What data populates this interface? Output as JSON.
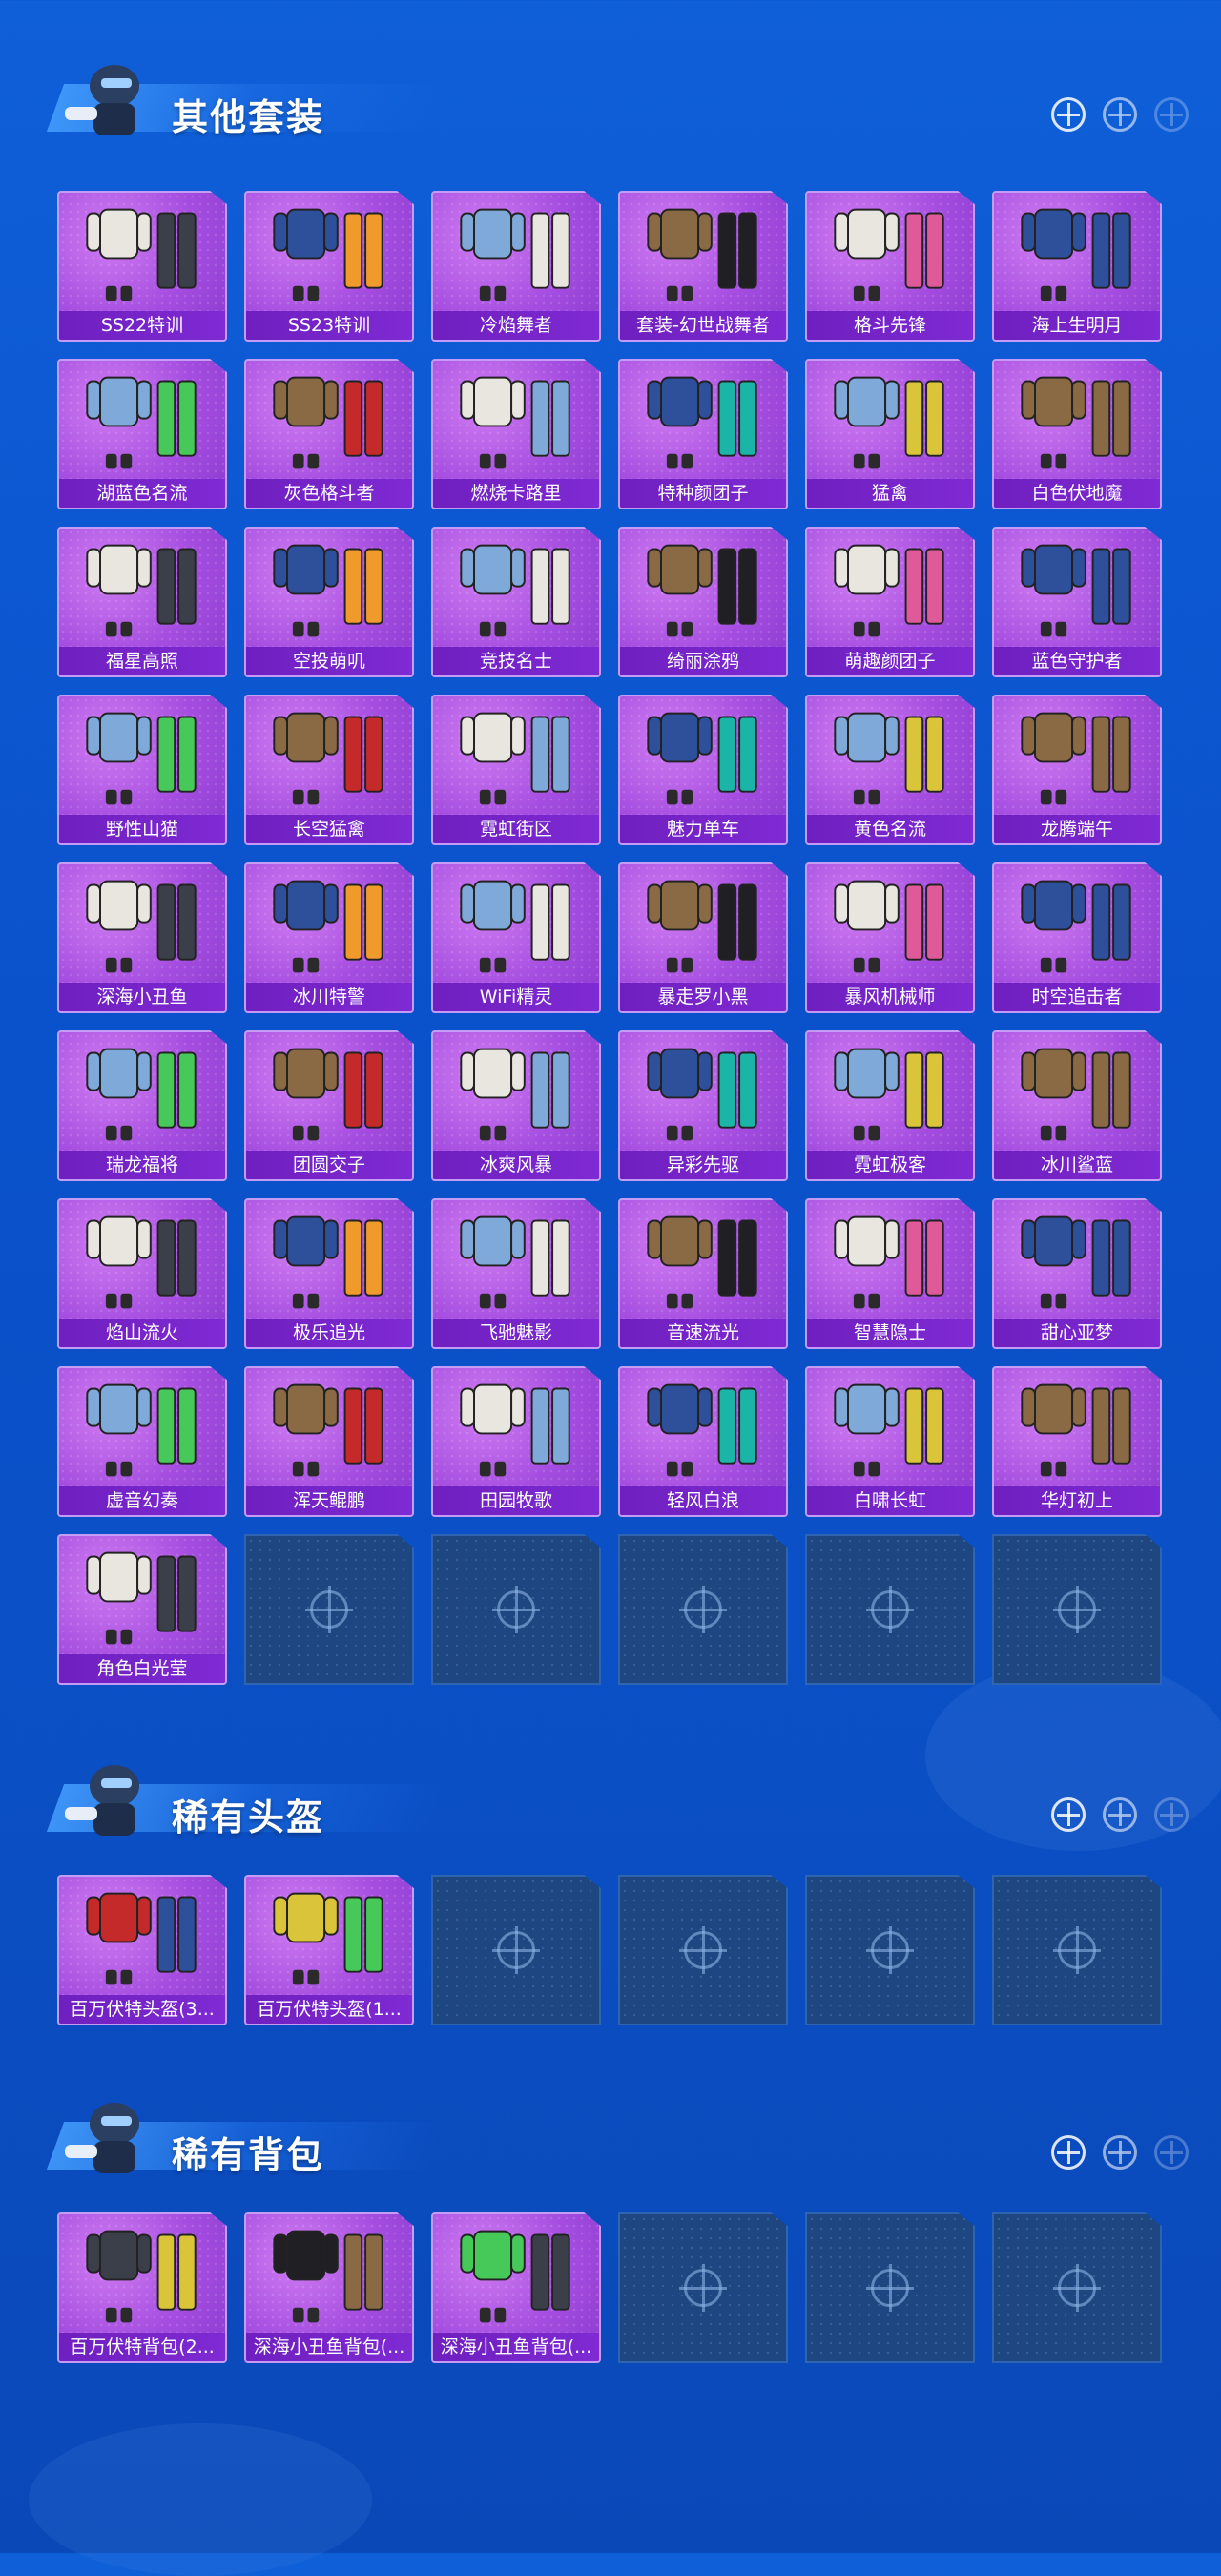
{
  "sections": [
    {
      "title": "其他套装",
      "items": [
        "SS22特训",
        "SS23特训",
        "冷焰舞者",
        "套装-幻世战舞者",
        "格斗先锋",
        "海上生明月",
        "湖蓝色名流",
        "灰色格斗者",
        "燃烧卡路里",
        "特种颜团子",
        "猛禽",
        "白色伏地魔",
        "福星高照",
        "空投萌叽",
        "竞技名士",
        "绮丽涂鸦",
        "萌趣颜团子",
        "蓝色守护者",
        "野性山猫",
        "长空猛禽",
        "霓虹街区",
        "魅力单车",
        "黄色名流",
        "龙腾端午",
        "深海小丑鱼",
        "冰川特警",
        "WiFi精灵",
        "暴走罗小黑",
        "暴风机械师",
        "时空追击者",
        "瑞龙福将",
        "团圆交子",
        "冰爽风暴",
        "异彩先驱",
        "霓虹极客",
        "冰川鲨蓝",
        "焰山流火",
        "极乐追光",
        "飞驰魅影",
        "音速流光",
        "智慧隐士",
        "甜心亚梦",
        "虚音幻奏",
        "浑天鲲鹏",
        "田园牧歌",
        "轻风白浪",
        "白啸长虹",
        "华灯初上",
        "角色白光莹"
      ],
      "empty_slots": 5
    },
    {
      "title": "稀有头盔",
      "items": [
        "百万伏特头盔(3...",
        "百万伏特头盔(1..."
      ],
      "empty_slots": 4
    },
    {
      "title": "稀有背包",
      "items": [
        "百万伏特背包(2...",
        "深海小丑鱼背包(...",
        "深海小丑鱼背包(..."
      ],
      "empty_slots": 3
    }
  ],
  "colors": {
    "card_purple": "#a54de0",
    "label_bar": "#6f1fbf",
    "empty_slot": "#1e4781",
    "background": "#0a52cc"
  },
  "icons": {
    "header_decor": "crosshair-icon",
    "empty_slot": "crosshair-icon"
  }
}
